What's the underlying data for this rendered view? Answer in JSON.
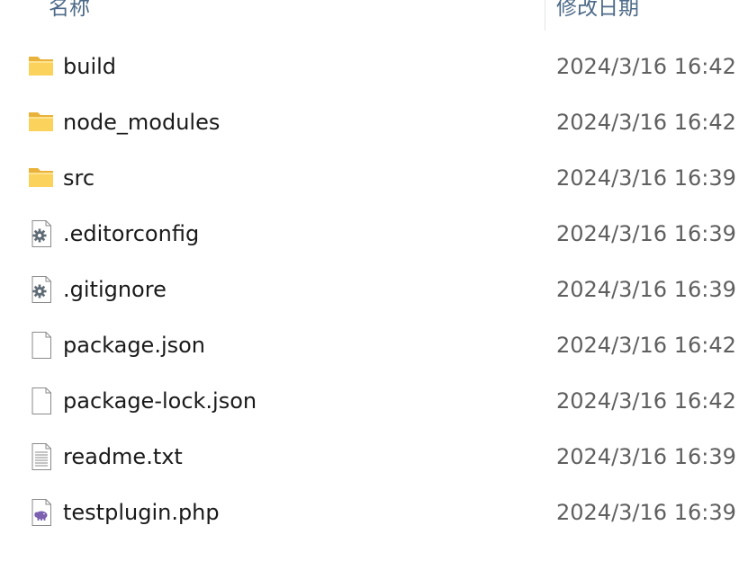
{
  "header": {
    "name_label": "名称",
    "date_label": "修改日期"
  },
  "items": [
    {
      "name": "build",
      "date": "2024/3/16 16:42",
      "icon": "folder-icon"
    },
    {
      "name": "node_modules",
      "date": "2024/3/16 16:42",
      "icon": "folder-icon"
    },
    {
      "name": "src",
      "date": "2024/3/16 16:39",
      "icon": "folder-icon"
    },
    {
      "name": ".editorconfig",
      "date": "2024/3/16 16:39",
      "icon": "config-file-icon"
    },
    {
      "name": ".gitignore",
      "date": "2024/3/16 16:39",
      "icon": "config-file-icon"
    },
    {
      "name": "package.json",
      "date": "2024/3/16 16:42",
      "icon": "blank-file-icon"
    },
    {
      "name": "package-lock.json",
      "date": "2024/3/16 16:42",
      "icon": "blank-file-icon"
    },
    {
      "name": "readme.txt",
      "date": "2024/3/16 16:39",
      "icon": "text-file-icon"
    },
    {
      "name": "testplugin.php",
      "date": "2024/3/16 16:39",
      "icon": "php-file-icon"
    }
  ],
  "colors": {
    "header_text": "#4d6a88",
    "name_text": "#1a1a1a",
    "date_text": "#5f5f5f",
    "folder": "#f8c94a"
  }
}
